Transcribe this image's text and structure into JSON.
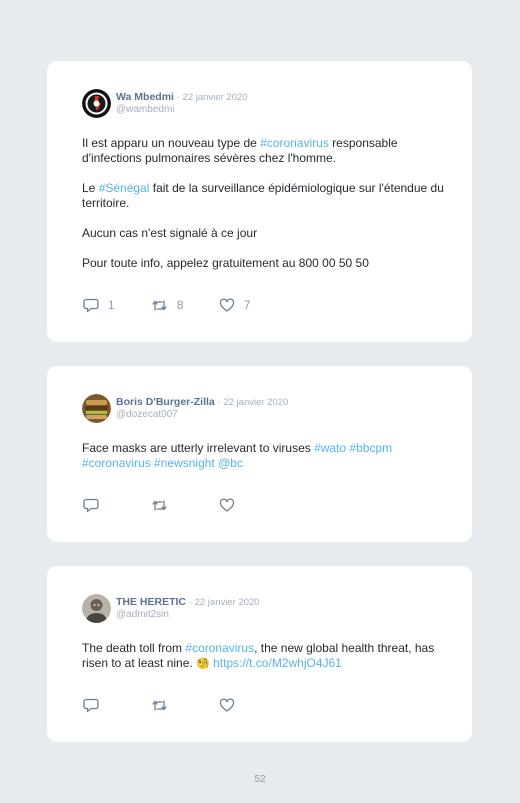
{
  "tweets": [
    {
      "name": "Wa Mbedmi",
      "date": "· 22 janvier 2020",
      "handle": "@wambedmi",
      "paragraphs": [
        [
          {
            "t": "Il est apparu un nouveau type de "
          },
          {
            "t": "#coronavirus",
            "tag": true
          },
          {
            "t": " responsable d'infections pulmonaires sévères chez l'homme."
          }
        ],
        [
          {
            "t": "Le "
          },
          {
            "t": "#Sénégal",
            "tag": true
          },
          {
            "t": " fait de la surveillance épidémiologique sur l'étendue du territoire."
          }
        ],
        [
          {
            "t": "Aucun cas n'est signalé à ce jour"
          }
        ],
        [
          {
            "t": "Pour toute info, appelez gratuitement au 800 00 50 50"
          }
        ]
      ],
      "reply_count": "1",
      "retweet_count": "8",
      "like_count": "7"
    },
    {
      "name": "Boris D'Burger-Zilla",
      "date": "· 22 janvier 2020",
      "handle": "@dozecat007",
      "paragraphs": [
        [
          {
            "t": "Face masks are utterly irrelevant to viruses "
          },
          {
            "t": "#wato",
            "tag": true
          },
          {
            "t": " "
          },
          {
            "t": "#bbcpm",
            "tag": true
          },
          {
            "t": " "
          },
          {
            "t": "#coronavirus",
            "tag": true
          },
          {
            "t": " "
          },
          {
            "t": "#newsnight",
            "tag": true
          },
          {
            "t": " "
          },
          {
            "t": "@bc",
            "tag": true
          }
        ]
      ],
      "reply_count": "",
      "retweet_count": "",
      "like_count": ""
    },
    {
      "name": "THE HERETIC",
      "date": "· 22 janvier 2020",
      "handle": "@admit2sin",
      "paragraphs": [
        [
          {
            "t": "The death toll from "
          },
          {
            "t": "#coronavirus",
            "tag": true
          },
          {
            "t": ", the new global health threat, has risen to at least nine. "
          },
          {
            "t": "🧐",
            "emoji": true
          },
          {
            "t": " "
          },
          {
            "t": "https://t.co/M2whjO4J61",
            "tag": true
          }
        ]
      ],
      "reply_count": "",
      "retweet_count": "",
      "like_count": ""
    }
  ],
  "page_number": "52",
  "colors": {
    "background": "#e6ebef",
    "card": "#ffffff",
    "name": "#5c7290",
    "muted": "#a3afbd",
    "text": "#262a2f",
    "link": "#55b4e8",
    "icon": "#6e7f8f"
  },
  "icons": [
    "reply-icon",
    "retweet-icon",
    "like-icon"
  ]
}
